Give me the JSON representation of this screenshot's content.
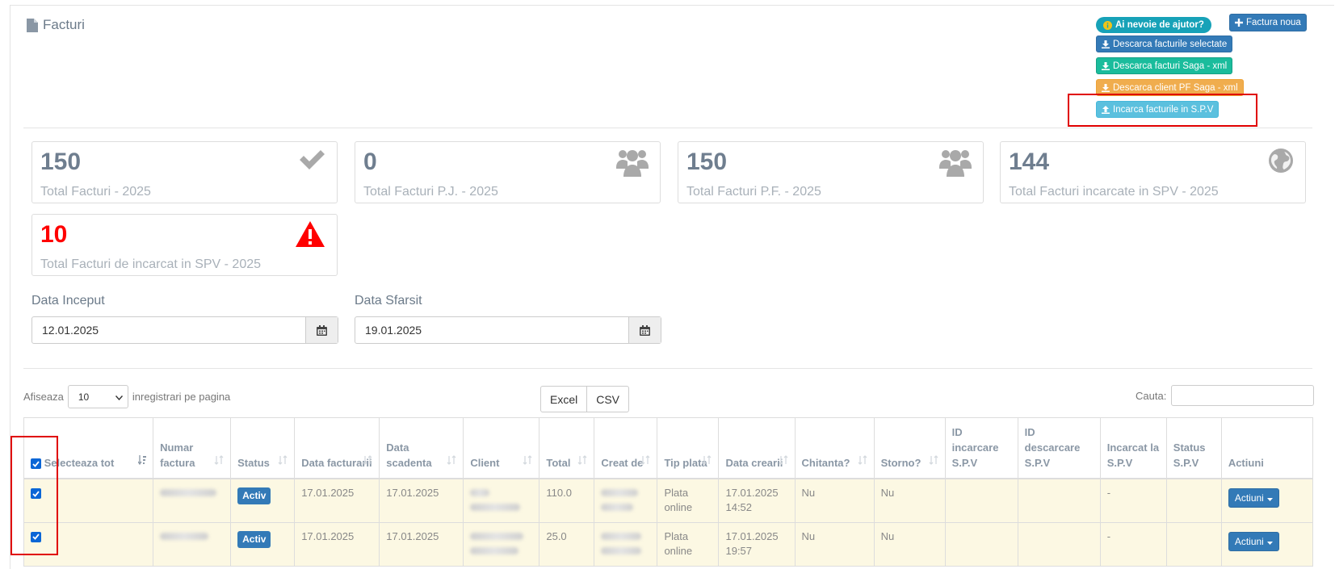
{
  "page": {
    "title": "Facturi",
    "icon": "file-icon"
  },
  "toolbar": {
    "help_label": "Ai nevoie de ajutor?",
    "new_invoice_label": "Factura noua",
    "download_selected_label": "Descarca facturile selectate",
    "download_saga_label": "Descarca facturi Saga - xml",
    "download_pf_saga_label": "Descarca client PF Saga - xml",
    "upload_spv_label": "Incarca facturile in S.P.V"
  },
  "stats": [
    {
      "value": "150",
      "label": "Total Facturi - 2025",
      "icon": "check-icon"
    },
    {
      "value": "0",
      "label": "Total Facturi P.J. - 2025",
      "icon": "users-icon"
    },
    {
      "value": "150",
      "label": "Total Facturi P.F. - 2025",
      "icon": "users-icon"
    },
    {
      "value": "144",
      "label": "Total Facturi incarcate in SPV - 2025",
      "icon": "globe-icon"
    },
    {
      "value": "10",
      "label": "Total Facturi de incarcat in SPV - 2025",
      "icon": "warning-icon",
      "color": "#ff0000"
    }
  ],
  "filters": {
    "start_label": "Data Inceput",
    "start_value": "12.01.2025",
    "end_label": "Data Sfarsit",
    "end_value": "19.01.2025"
  },
  "table_controls": {
    "show_label": "Afiseaza",
    "page_size": "10",
    "per_page_label": "inregistrari pe pagina",
    "export_excel": "Excel",
    "export_csv": "CSV",
    "search_label": "Cauta:"
  },
  "table": {
    "select_all_label": "Selecteaza tot",
    "columns": [
      "Numar factura",
      "Status",
      "Data facturarii",
      "Data scadenta",
      "Client",
      "Total",
      "Creat de",
      "Tip plata",
      "Data crearii",
      "Chitanta?",
      "Storno?",
      "ID incarcare S.P.V",
      "ID descarcare S.P.V",
      "Incarcat la S.P.V",
      "Status S.P.V",
      "Actiuni"
    ],
    "rows": [
      {
        "status": "Activ",
        "data_facturarii": "17.01.2025",
        "data_scadenta": "17.01.2025",
        "total": "110.0",
        "tip_plata": "Plata online",
        "data_crearii": "17.01.2025 14:52",
        "chitanta": "Nu",
        "storno": "Nu",
        "incarcat": "-",
        "actions": "Actiuni"
      },
      {
        "status": "Activ",
        "data_facturarii": "17.01.2025",
        "data_scadenta": "17.01.2025",
        "total": "25.0",
        "tip_plata": "Plata online",
        "data_crearii": "17.01.2025 19:57",
        "chitanta": "Nu",
        "storno": "Nu",
        "incarcat": "-",
        "actions": "Actiuni"
      }
    ]
  },
  "colors": {
    "primary": "#337ab7",
    "info": "#5bc0de",
    "success": "#1abc9c",
    "warning": "#f0ad4e",
    "danger": "#ff0000",
    "row_highlight": "#fcf8e3"
  }
}
